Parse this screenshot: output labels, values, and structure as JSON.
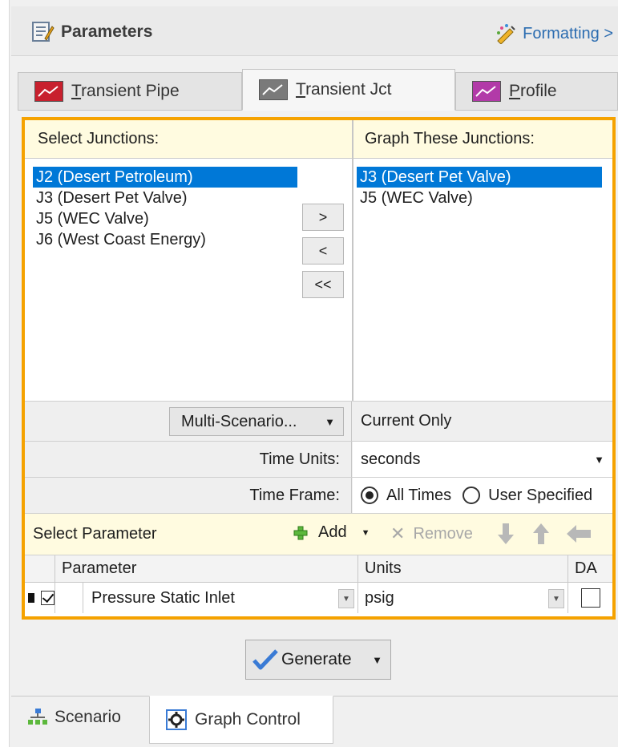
{
  "header": {
    "title": "Parameters",
    "formatting_label": "Formatting >"
  },
  "tabs": [
    {
      "label_ul": "T",
      "label_rest": "ransient Pipe",
      "color": "#c8202e"
    },
    {
      "label_ul": "T",
      "label_rest": "ransient Jct",
      "color": "#7a7a7a",
      "active": true
    },
    {
      "label_ul": "P",
      "label_rest": "rofile",
      "color": "#b23aa8"
    }
  ],
  "select": {
    "left_header": "Select Junctions:",
    "right_header": "Graph These Junctions:",
    "left_items": [
      "J2 (Desert Petroleum)",
      "J3 (Desert Pet Valve)",
      "J5 (WEC Valve)",
      "J6 (West Coast Energy)"
    ],
    "left_selected": 0,
    "right_items": [
      "J3 (Desert Pet Valve)",
      "J5 (WEC Valve)"
    ],
    "right_selected": 0,
    "buttons": {
      "add": ">",
      "remove": "<",
      "remove_all": "<<"
    }
  },
  "scenario": {
    "button_label": "Multi-Scenario...",
    "value": "Current Only"
  },
  "time_units": {
    "label": "Time Units:",
    "value": "seconds"
  },
  "time_frame": {
    "label": "Time Frame:",
    "option_all": "All Times",
    "option_user": "User Specified",
    "selected": "all"
  },
  "param_bar": {
    "title": "Select Parameter",
    "add": "Add",
    "remove": "Remove"
  },
  "grid": {
    "headers": {
      "parameter": "Parameter",
      "units": "Units",
      "da": "DA"
    },
    "rows": [
      {
        "checked": true,
        "parameter": "Pressure Static Inlet",
        "units": "psig",
        "da": false
      }
    ]
  },
  "generate_label": "Generate",
  "bottom_tabs": {
    "scenario": "Scenario",
    "graph_control": "Graph Control"
  },
  "colors": {
    "accent_border": "#f5a200",
    "selection": "#0078d7",
    "link": "#2b6cb0"
  }
}
